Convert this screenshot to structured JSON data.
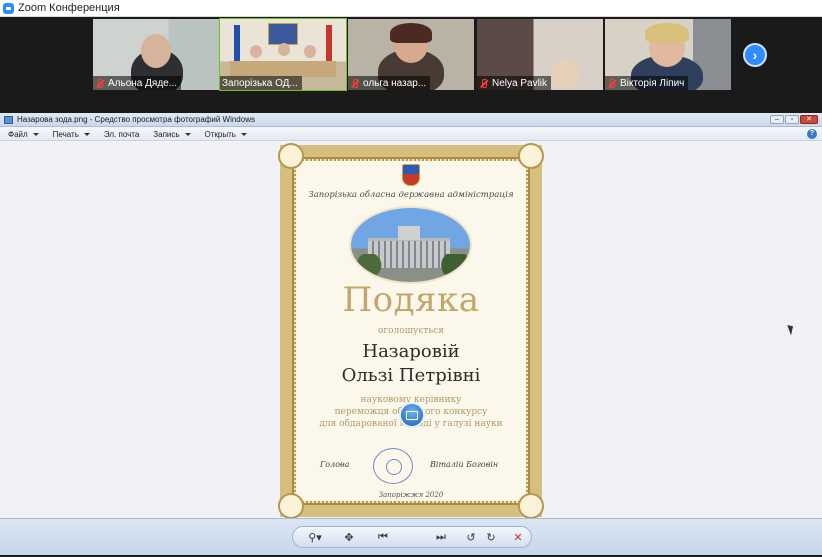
{
  "zoom": {
    "window_title": "Zoom Конференция",
    "participants": [
      {
        "name": "Альона Дяде...",
        "muted": true
      },
      {
        "name": "Запорізька ОД...",
        "muted": false,
        "active": true
      },
      {
        "name": "ольга назар...",
        "muted": true
      },
      {
        "name": "Nelya Pavlik",
        "muted": true
      },
      {
        "name": "Вікторія Ліпич",
        "muted": true
      }
    ],
    "next_icon": "chevron-right-icon"
  },
  "viewer": {
    "window_title": "Назарова зода.png - Средство просмотра фотографий Windows",
    "menu": [
      "Файл",
      "Печать",
      "Эл. почта",
      "Запись",
      "Открыть"
    ],
    "help_label": "?",
    "toolbar_icons": [
      "zoom-icon",
      "fit-icon",
      "previous-icon",
      "slideshow-icon",
      "next-icon",
      "rotate-left-icon",
      "rotate-right-icon",
      "delete-icon"
    ]
  },
  "certificate": {
    "organization": "Запорізька обласна державна адміністрація",
    "title": "Подяка",
    "subtitle": "оголошується",
    "name_line1": "Назаровій",
    "name_line2": "Ользі Петрівні",
    "body_line1": "науковому керівнику",
    "body_line2": "переможця обласного конкурсу",
    "body_line3": "для обдарованої молоді у галузі науки",
    "sign_left": "Голова",
    "sign_right": "Віталій Боговін",
    "city_year": "Запоріжжя 2020"
  },
  "colors": {
    "zoom_blue": "#2d8cff",
    "active_speaker": "#6fbe2c",
    "mute_red": "#ff3b30",
    "cert_gold": "#c2a76a"
  }
}
